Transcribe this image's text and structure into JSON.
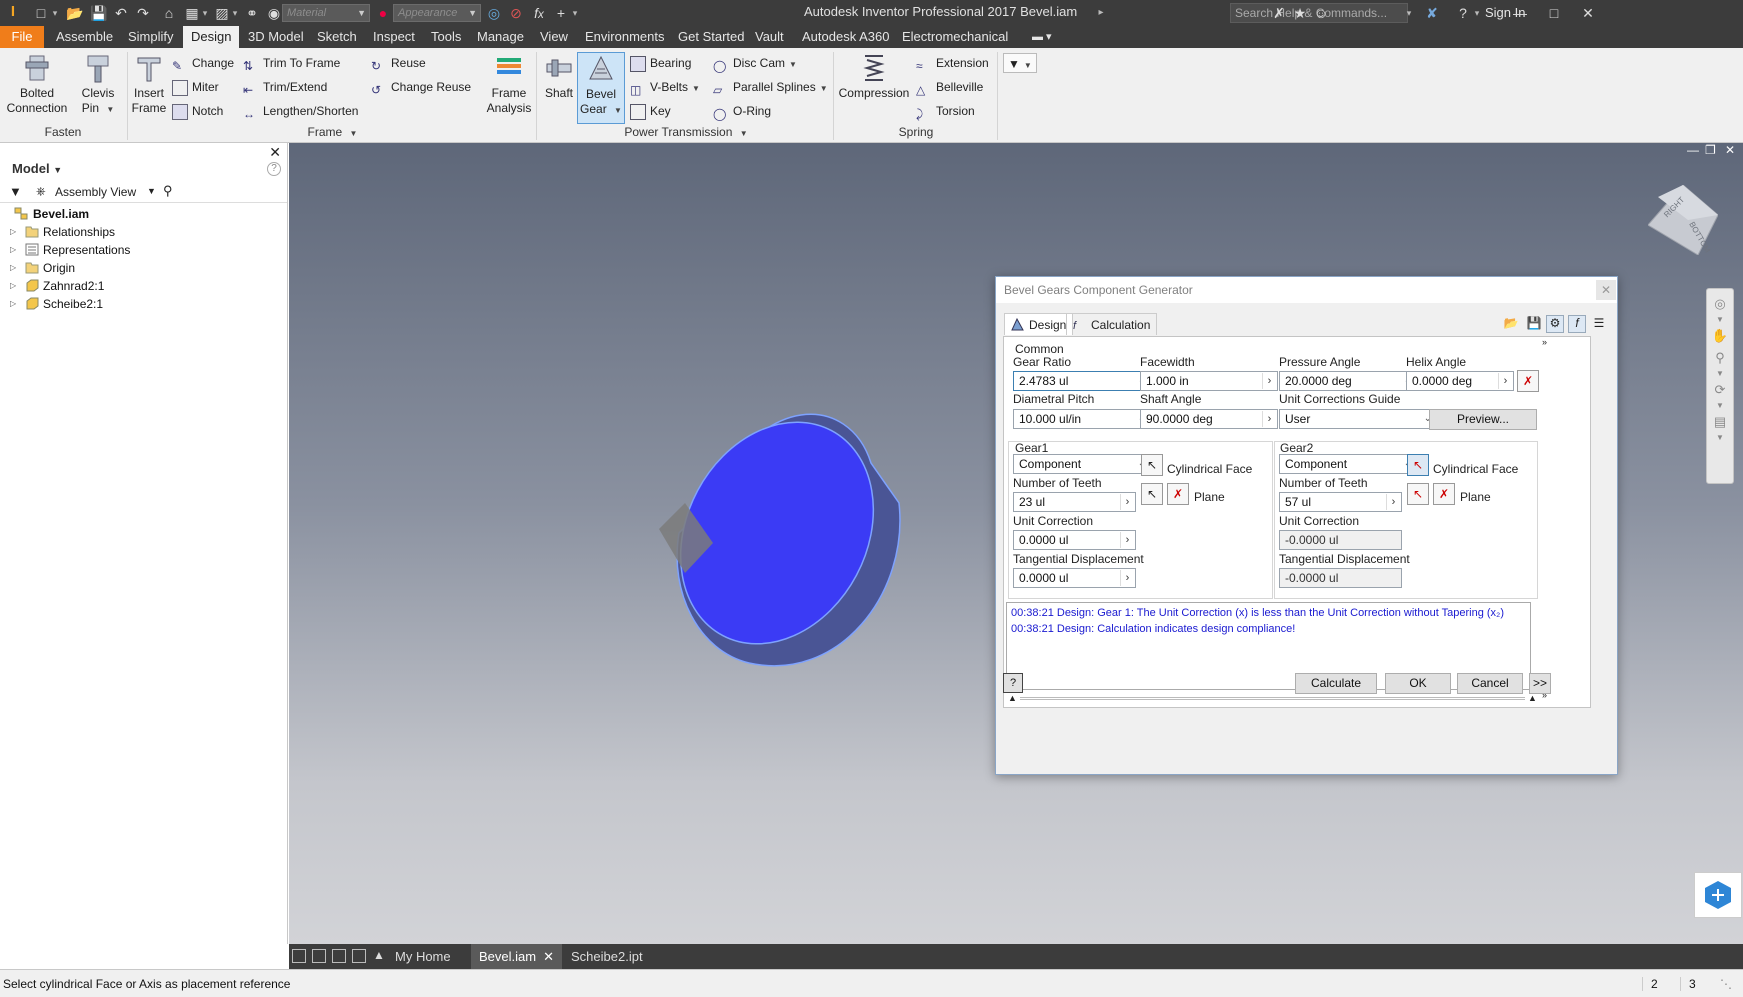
{
  "app": {
    "title": "Autodesk Inventor Professional 2017   Bevel.iam",
    "search_placeholder": "Search Help & Commands...",
    "sign_in": "Sign In",
    "material_placeholder": "Material",
    "appearance_placeholder": "Appearance"
  },
  "ribbon_tabs": [
    "File",
    "Assemble",
    "Simplify",
    "Design",
    "3D Model",
    "Sketch",
    "Inspect",
    "Tools",
    "Manage",
    "View",
    "Environments",
    "Get Started",
    "Vault",
    "Autodesk A360",
    "Electromechanical"
  ],
  "active_tab": "Design",
  "ribbon": {
    "fasten": {
      "title": "Fasten",
      "bolted": "Bolted Connection",
      "bolted_l1": "Bolted",
      "bolted_l2": "Connection",
      "clevis_l1": "Clevis",
      "clevis_l2": "Pin"
    },
    "frame": {
      "title": "Frame",
      "insert_l1": "Insert",
      "insert_l2": "Frame",
      "change": "Change",
      "miter": "Miter",
      "notch": "Notch",
      "trim_to_frame": "Trim To Frame",
      "trim_extend": "Trim/Extend",
      "lengthen": "Lengthen/Shorten",
      "reuse": "Reuse",
      "change_reuse": "Change Reuse",
      "analysis_l1": "Frame",
      "analysis_l2": "Analysis"
    },
    "power": {
      "title": "Power Transmission",
      "shaft": "Shaft",
      "bevel_l1": "Bevel",
      "bevel_l2": "Gear",
      "bearing": "Bearing",
      "vbelts": "V-Belts",
      "key": "Key",
      "disc_cam": "Disc Cam",
      "parallel_splines": "Parallel Splines",
      "oring": "O-Ring"
    },
    "spring": {
      "title": "Spring",
      "compression": "Compression",
      "extension": "Extension",
      "belleville": "Belleville",
      "torsion": "Torsion"
    }
  },
  "browser": {
    "title": "Model",
    "view": "Assembly View",
    "items": [
      {
        "label": "Bevel.iam",
        "bold": true
      },
      {
        "label": "Relationships"
      },
      {
        "label": "Representations"
      },
      {
        "label": "Origin"
      },
      {
        "label": "Zahnrad2:1"
      },
      {
        "label": "Scheibe2:1"
      }
    ]
  },
  "viewcube": {
    "right": "RIGHT",
    "bottom": "BOTTOM"
  },
  "dialog": {
    "title": "Bevel Gears Component Generator",
    "tab_design": "Design",
    "tab_calculation": "Calculation",
    "common": "Common",
    "gear_ratio_label": "Gear Ratio",
    "gear_ratio": "2.4783 ul",
    "facewidth_label": "Facewidth",
    "facewidth": "1.000 in",
    "pressure_angle_label": "Pressure Angle",
    "pressure_angle": "20.0000 deg",
    "helix_angle_label": "Helix Angle",
    "helix_angle": "0.0000 deg",
    "diametral_pitch_label": "Diametral Pitch",
    "diametral_pitch": "10.000 ul/in",
    "shaft_angle_label": "Shaft Angle",
    "shaft_angle": "90.0000 deg",
    "unit_corr_guide_label": "Unit Corrections Guide",
    "unit_corr_guide": "User",
    "preview": "Preview...",
    "gear1": {
      "title": "Gear1",
      "type": "Component",
      "cyl_face": "Cylindrical Face",
      "plane": "Plane",
      "teeth_label": "Number of Teeth",
      "teeth": "23 ul",
      "unit_corr_label": "Unit Correction",
      "unit_corr": "0.0000 ul",
      "tang_label": "Tangential Displacement",
      "tang": "0.0000 ul"
    },
    "gear2": {
      "title": "Gear2",
      "type": "Component",
      "cyl_face": "Cylindrical Face",
      "plane": "Plane",
      "teeth_label": "Number of Teeth",
      "teeth": "57 ul",
      "unit_corr_label": "Unit Correction",
      "unit_corr": "-0.0000 ul",
      "tang_label": "Tangential Displacement",
      "tang": "-0.0000 ul"
    },
    "messages": [
      "00:38:21 Design: Gear 1: The Unit Correction (x) is less than the Unit Correction without Tapering (x₂)",
      "00:38:21 Design: Calculation indicates design compliance!"
    ],
    "calculate": "Calculate",
    "ok": "OK",
    "cancel": "Cancel",
    "more": ">>"
  },
  "doc_tabs": [
    "My Home",
    "Bevel.iam",
    "Scheibe2.ipt"
  ],
  "active_doc": "Bevel.iam",
  "status": {
    "text": "Select cylindrical Face or Axis as placement reference",
    "n1": "2",
    "n2": "3"
  },
  "colors": {
    "accent": "#f07d1a",
    "gear_face": "#3b3bf5",
    "dark_chrome": "#3c3c3c"
  }
}
